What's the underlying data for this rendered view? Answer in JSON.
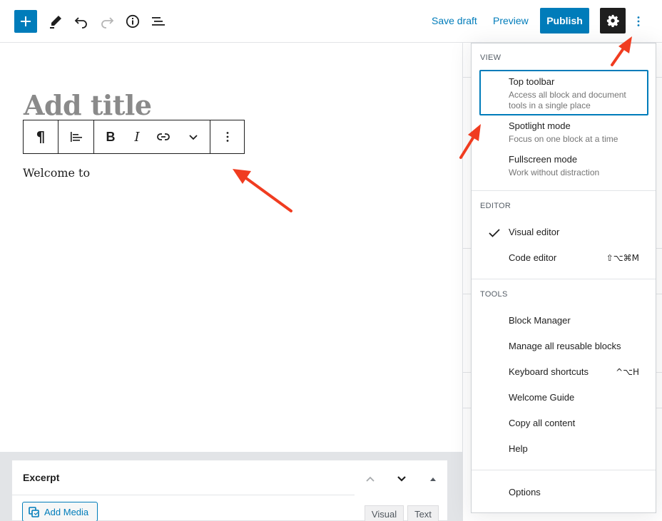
{
  "header": {
    "save_draft": "Save draft",
    "preview": "Preview",
    "publish": "Publish"
  },
  "editor": {
    "title_placeholder": "Add title",
    "paragraph": "Welcome to"
  },
  "block_toolbar": {
    "paragraph_glyph": "¶",
    "bold": "B",
    "italic": "I"
  },
  "menu": {
    "view": {
      "label": "View",
      "items": [
        {
          "label": "Top toolbar",
          "description": "Access all block and document tools in a single place"
        },
        {
          "label": "Spotlight mode",
          "description": "Focus on one block at a time"
        },
        {
          "label": "Fullscreen mode",
          "description": "Work without distraction"
        }
      ]
    },
    "editor": {
      "label": "Editor",
      "items": [
        {
          "label": "Visual editor",
          "checked": true
        },
        {
          "label": "Code editor",
          "shortcut": "⇧⌥⌘M"
        }
      ]
    },
    "tools": {
      "label": "Tools",
      "items": [
        {
          "label": "Block Manager"
        },
        {
          "label": "Manage all reusable blocks"
        },
        {
          "label": "Keyboard shortcuts",
          "shortcut": "^⌥H"
        },
        {
          "label": "Welcome Guide"
        },
        {
          "label": "Copy all content"
        },
        {
          "label": "Help"
        }
      ]
    },
    "options": "Options"
  },
  "excerpt": {
    "title": "Excerpt",
    "add_media": "Add Media",
    "tab_visual": "Visual",
    "tab_text": "Text"
  },
  "colors": {
    "accent": "#007cba",
    "annotation": "#f03c20"
  }
}
